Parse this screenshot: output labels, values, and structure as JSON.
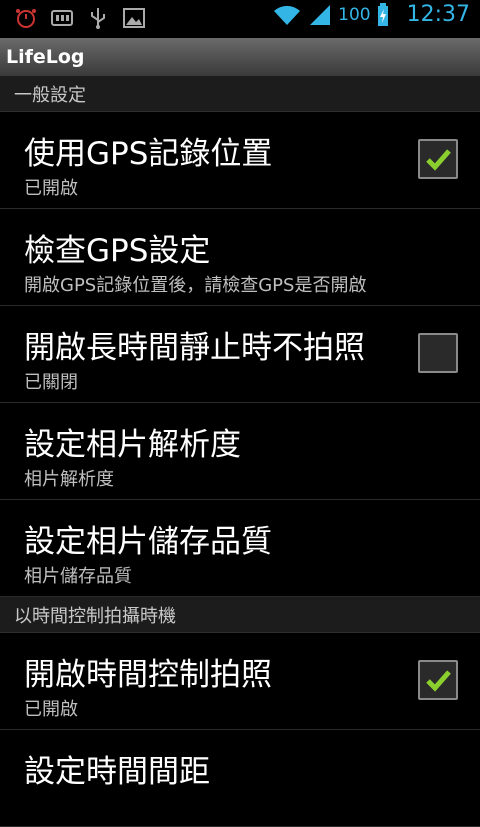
{
  "status_bar": {
    "left_icons": [
      "alarm-icon",
      "storage-icon",
      "usb-icon",
      "image-icon"
    ],
    "battery_percent": "100",
    "time": "12:37",
    "accent": "#33b5e5"
  },
  "app": {
    "title": "LifeLog"
  },
  "sections": [
    {
      "header": "一般設定",
      "items": [
        {
          "title": "使用GPS記錄位置",
          "summary": "已開啟",
          "checkbox": true,
          "checked": true
        },
        {
          "title": "檢查GPS設定",
          "summary": "開啟GPS記錄位置後，請檢查GPS是否開啟",
          "checkbox": false
        },
        {
          "title": "開啟長時間靜止時不拍照",
          "summary": "已關閉",
          "checkbox": true,
          "checked": false
        },
        {
          "title": "設定相片解析度",
          "summary": "相片解析度",
          "checkbox": false
        },
        {
          "title": "設定相片儲存品質",
          "summary": "相片儲存品質",
          "checkbox": false
        }
      ]
    },
    {
      "header": "以時間控制拍攝時機",
      "items": [
        {
          "title": "開啟時間控制拍照",
          "summary": "已開啟",
          "checkbox": true,
          "checked": true
        },
        {
          "title": "設定時間間距",
          "summary": "",
          "checkbox": false
        }
      ]
    }
  ],
  "colors": {
    "check_green": "#8bcf2f",
    "list_bg": "#000000",
    "category_bg": "#1c1c1c"
  }
}
